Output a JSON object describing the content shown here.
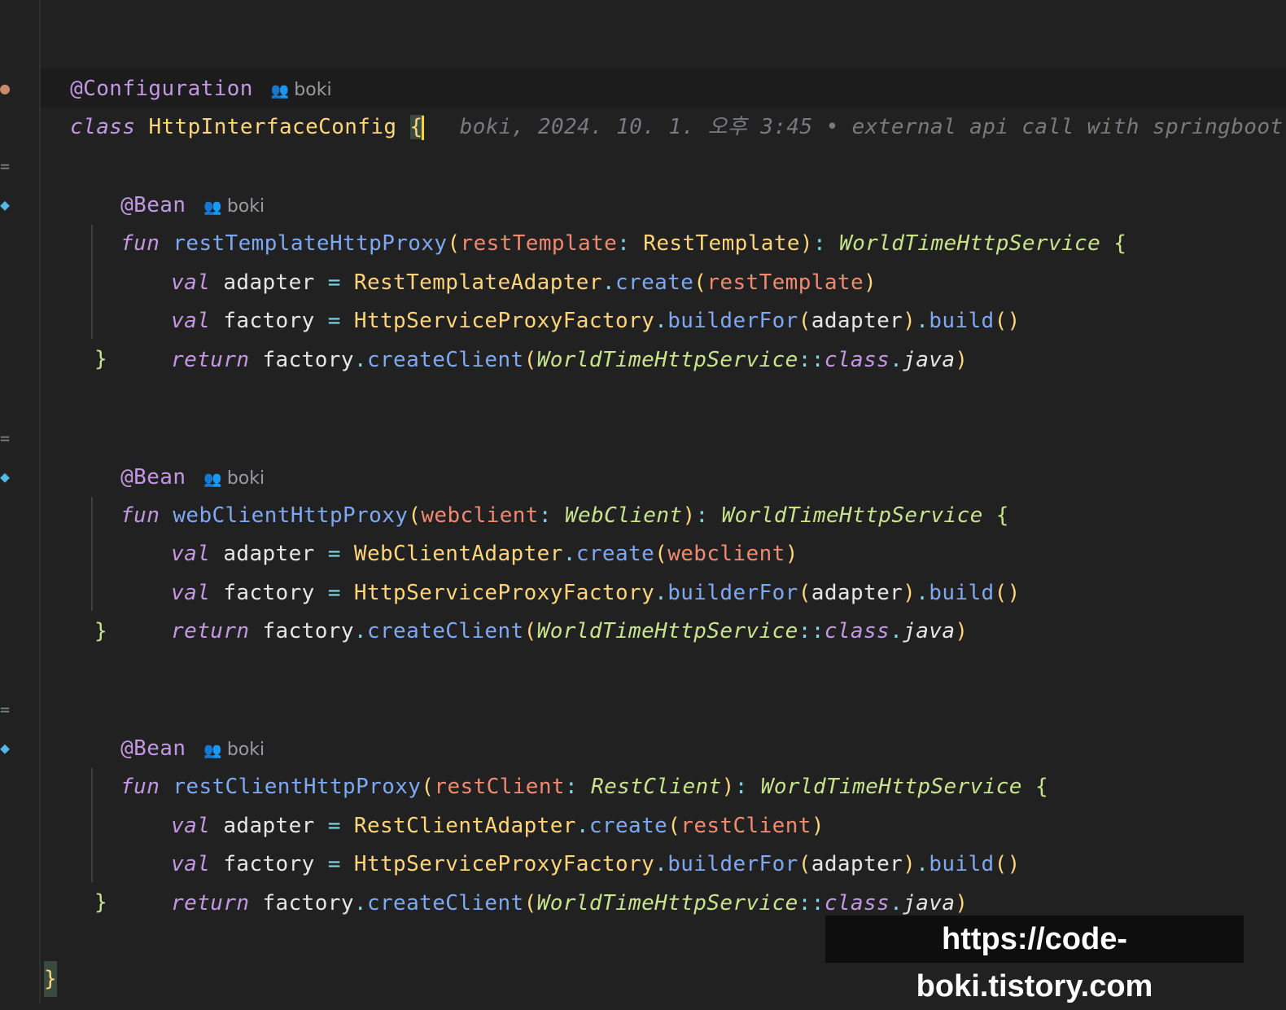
{
  "annotation_configuration": "@Configuration",
  "author": "boki",
  "class_keyword": "class",
  "class_name": "HttpInterfaceConfig",
  "open_brace": "{",
  "close_brace": "}",
  "blame": "boki, 2024. 10. 1. 오후 3:45 • external api call with springboot",
  "annotation_bean": "@Bean",
  "keywords": {
    "fun": "fun",
    "val": "val",
    "return": "return",
    "class": "class",
    "java": "java"
  },
  "return_type": "WorldTimeHttpService",
  "common": {
    "adapter": "adapter",
    "factory": "factory",
    "proxy_factory": "HttpServiceProxyFactory",
    "builder_for": "builderFor",
    "build": "build",
    "create": "create",
    "create_client": "createClient",
    "service_ref": "WorldTimeHttpService"
  },
  "methods": [
    {
      "name": "restTemplateHttpProxy",
      "param": "restTemplate",
      "param_type": "RestTemplate",
      "adapter_class": "RestTemplateAdapter"
    },
    {
      "name": "webClientHttpProxy",
      "param": "webclient",
      "param_type": "WebClient",
      "adapter_class": "WebClientAdapter"
    },
    {
      "name": "restClientHttpProxy",
      "param": "restClient",
      "param_type": "RestClient",
      "adapter_class": "RestClientAdapter"
    }
  ],
  "watermark": "https://code-boki.tistory.com",
  "colors": {
    "background": "#212122",
    "keyword": "#c497e3",
    "class": "#ffd57a",
    "type": "#c7e48c",
    "function": "#7fa8f3",
    "param": "#f08a71"
  },
  "icons": [
    "people-icon",
    "implements-icon",
    "bean-gutter-icon",
    "debug-avatar-icon"
  ]
}
